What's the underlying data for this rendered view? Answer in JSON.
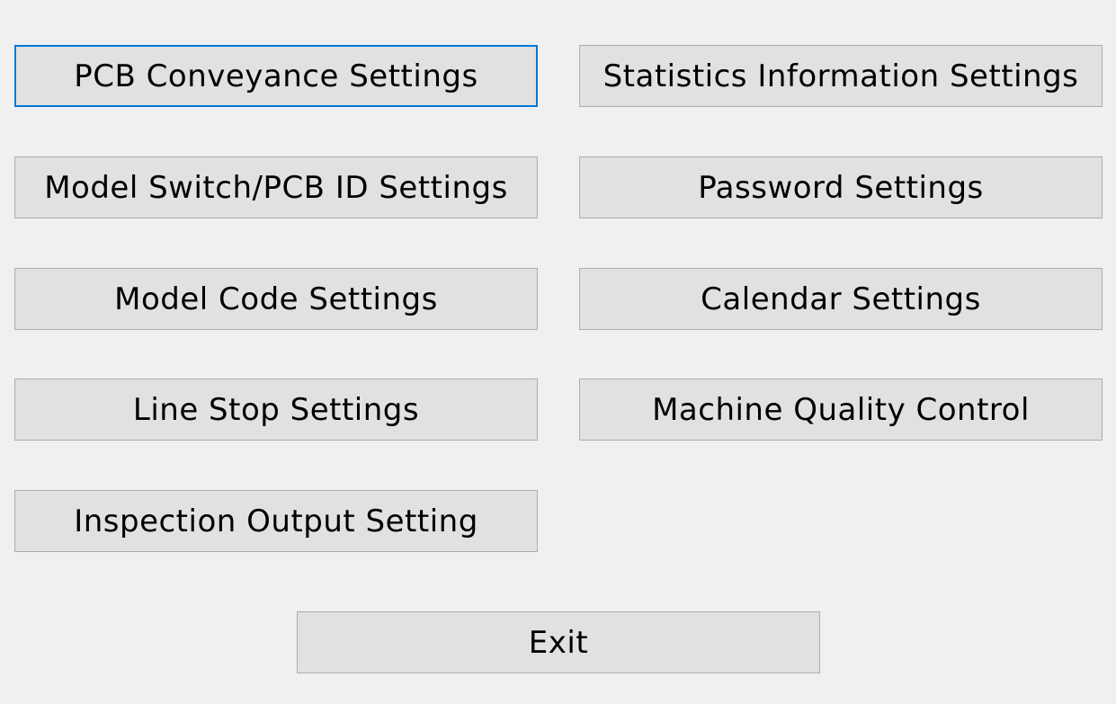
{
  "buttons": {
    "pcb_conveyance": "PCB Conveyance Settings",
    "statistics_information": "Statistics Information Settings",
    "model_switch_pcb_id": "Model Switch/PCB ID Settings",
    "password": "Password Settings",
    "model_code": "Model Code Settings",
    "calendar": "Calendar Settings",
    "line_stop": "Line Stop Settings",
    "machine_quality_control": "Machine Quality Control",
    "inspection_output": "Inspection Output Setting",
    "exit": "Exit"
  },
  "colors": {
    "background": "#f0f0f0",
    "button_face": "#e1e1e1",
    "button_border": "#adadad",
    "focus_border": "#0078d7"
  }
}
